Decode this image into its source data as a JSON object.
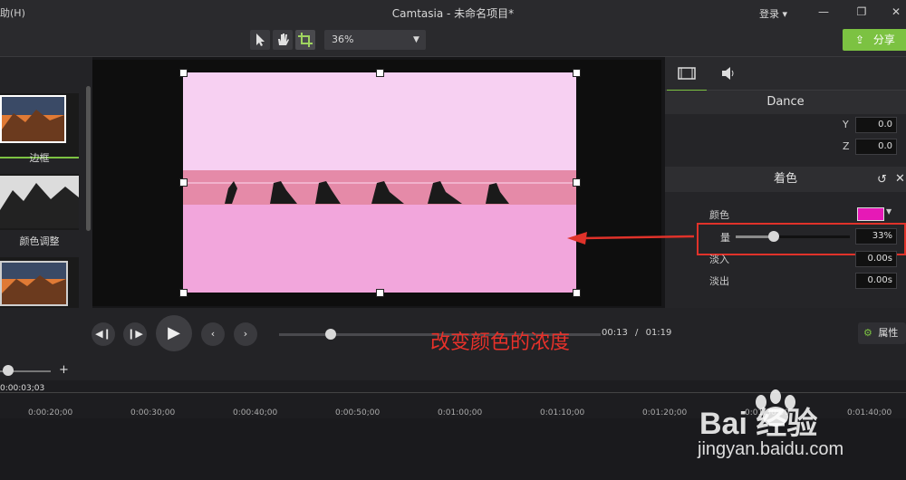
{
  "window": {
    "menu_tail": "助(H)",
    "title": "Camtasia - 未命名项目*",
    "login": "登录 ▾",
    "minimize": "—",
    "restore": "❐",
    "close": "✕"
  },
  "toolbar": {
    "zoom_value": "36%",
    "share_label": "分享",
    "tools": [
      "pointer-icon",
      "hand-icon",
      "crop-icon"
    ]
  },
  "library": {
    "items": [
      {
        "label": "边框"
      },
      {
        "label": "颜色调整"
      },
      {
        "label": ""
      }
    ]
  },
  "properties": {
    "clip_name": "Dance",
    "y_label": "Y",
    "y_value": "0.0",
    "z_label": "Z",
    "z_value": "0.0",
    "tint_section": "着色",
    "color_label": "颜色",
    "color_value": "#e619b6",
    "amount_label": "量",
    "amount_value": "33%",
    "amount_level": 0.33,
    "fade_in_label": "淡入",
    "fade_in_value": "0.00s",
    "fade_out_label": "淡出",
    "fade_out_value": "0.00s"
  },
  "playback": {
    "current_time": "00:13",
    "separator": "/",
    "total_time": "01:19",
    "properties_button": "属性",
    "progress": 0.16
  },
  "annotation": {
    "text": "改变颜色的浓度",
    "color": "#e8312a"
  },
  "timeline": {
    "playhead_label": "0:00:03;03",
    "ticks": [
      "0:00:20;00",
      "0:00:30;00",
      "0:00:40;00",
      "0:00:50;00",
      "0:01:00;00",
      "0:01:10;00",
      "0:01:20;00",
      "0:01:30;00",
      "0:01:40;00"
    ]
  },
  "watermark": {
    "brand": "Bai 经验",
    "url": "jingyan.baidu.com"
  },
  "colors": {
    "accent": "#7cc242",
    "tint": "#e619b6",
    "annotation_red": "#e0322a"
  }
}
